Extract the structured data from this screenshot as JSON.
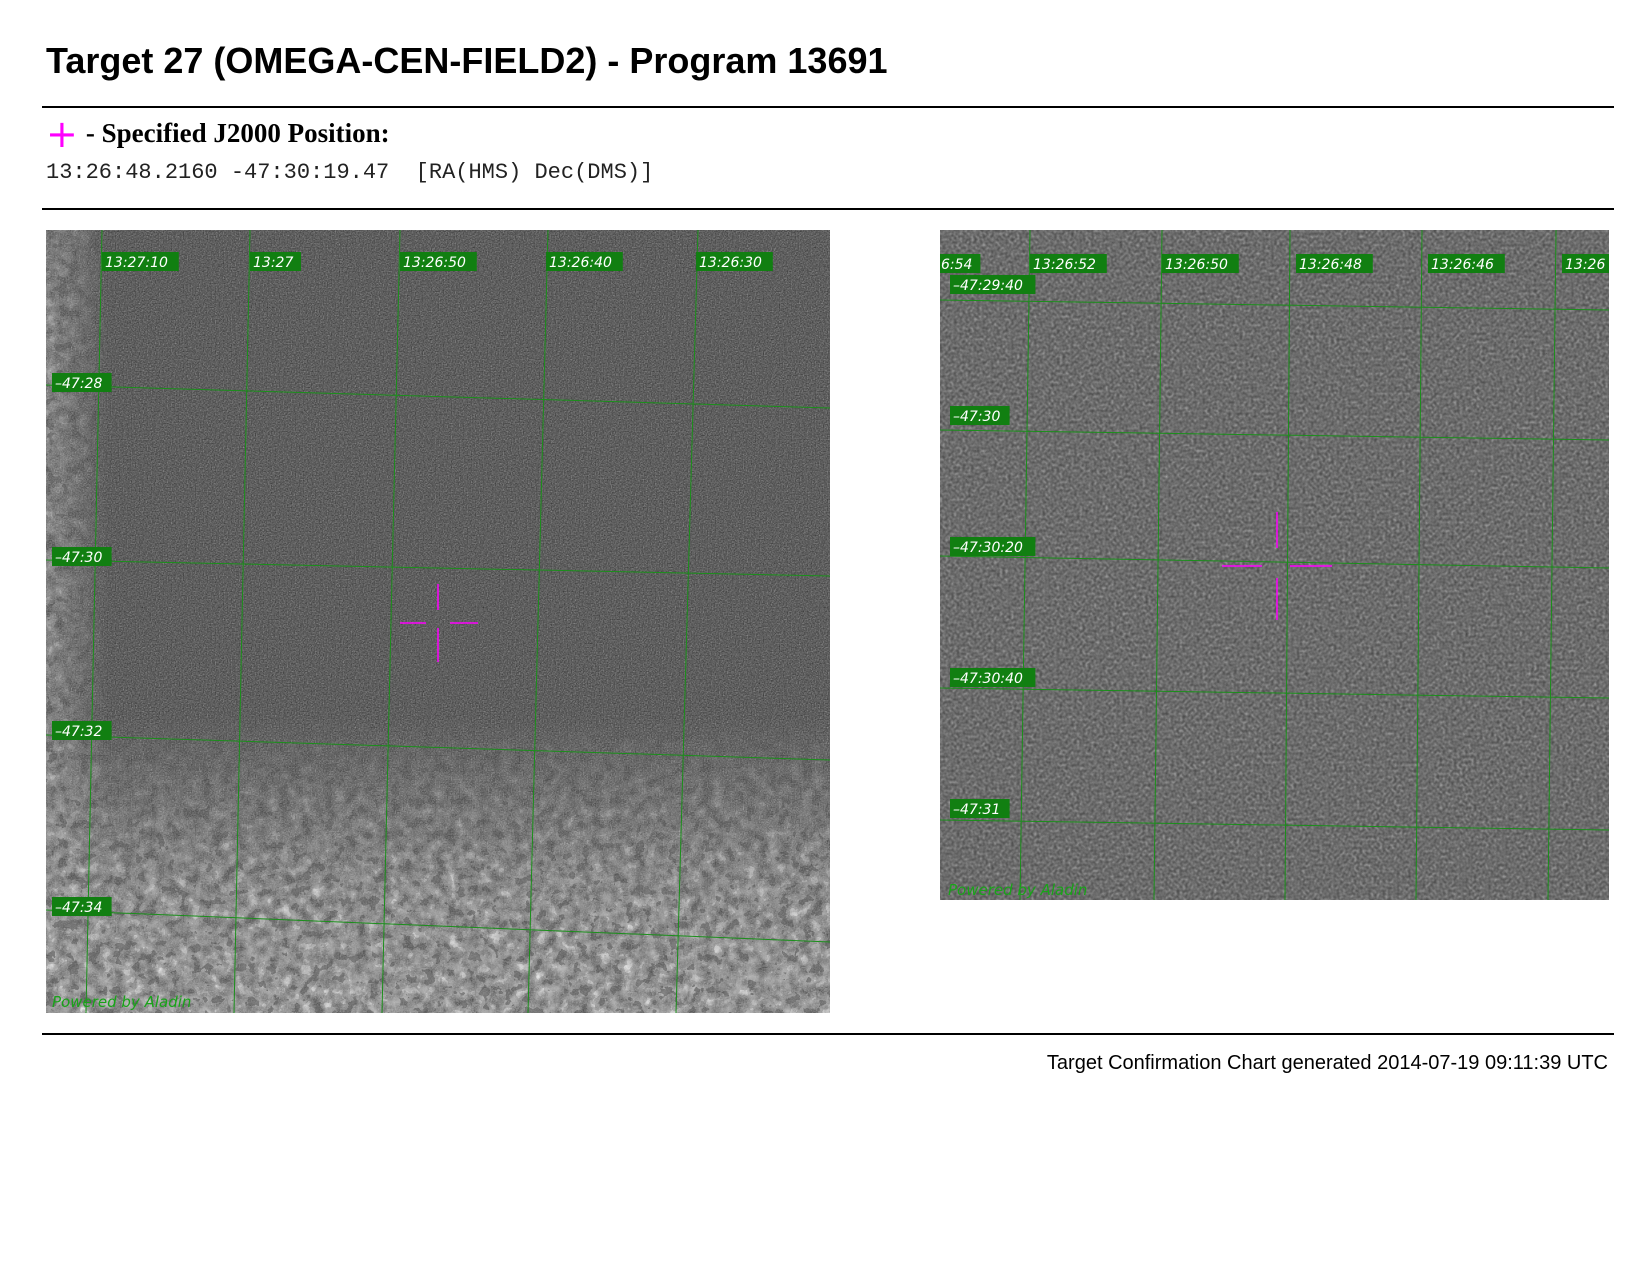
{
  "header": {
    "title": "Target 27 (OMEGA-CEN-FIELD2) - Program 13691"
  },
  "position": {
    "legend_symbol": "+",
    "legend_label": "- Specified J2000 Position:",
    "coordinates": "13:26:48.2160 -47:30:19.47  [RA(HMS) Dec(DMS)]"
  },
  "panels": {
    "wide": {
      "ra_labels": [
        "13:27:10",
        "13:27",
        "13:26:50",
        "13:26:40",
        "13:26:30"
      ],
      "dec_labels": [
        "-47:28",
        "-47:30",
        "-47:32",
        "-47:34"
      ],
      "credit": "Powered by Aladin"
    },
    "zoom": {
      "ra_labels": [
        "6:54",
        "13:26:52",
        "13:26:50",
        "13:26:48",
        "13:26:46",
        "13:26"
      ],
      "dec_labels": [
        "-47:29:40",
        "-47:30",
        "-47:30:20",
        "-47:30:40",
        "-47:31"
      ],
      "credit": "Powered by Aladin"
    }
  },
  "footer": {
    "generated": "Target Confirmation Chart generated 2014-07-19 09:11:39 UTC"
  },
  "colors": {
    "marker": "#ff00ff",
    "grid": "#1a8f1a",
    "label_bg": "#117f11"
  }
}
